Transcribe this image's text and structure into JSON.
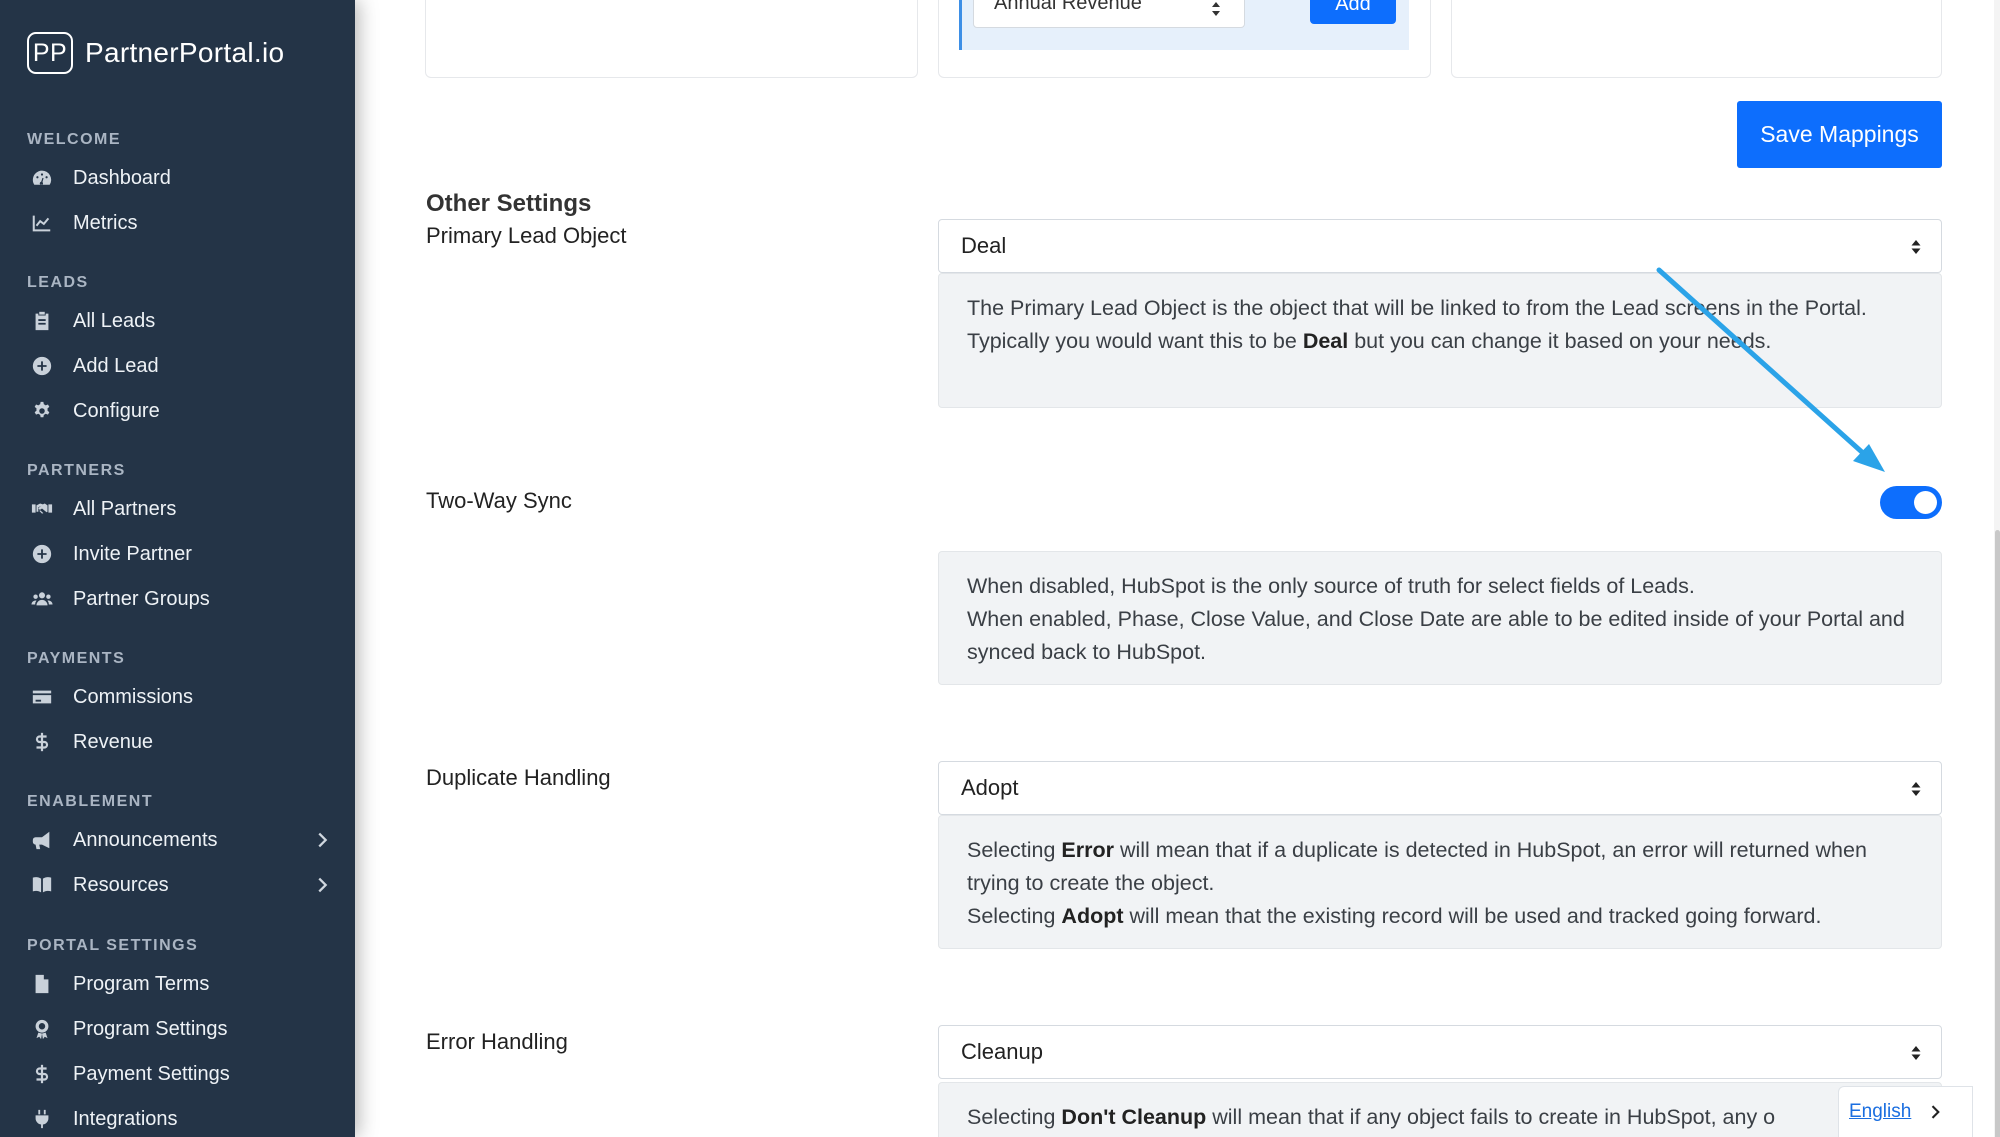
{
  "brand": {
    "logo": "PP",
    "name": "PartnerPortal.io"
  },
  "sidebar": {
    "sections": [
      {
        "title": "WELCOME",
        "items": [
          {
            "label": "Dashboard",
            "icon": "dashboard-gauge-icon"
          },
          {
            "label": "Metrics",
            "icon": "line-chart-icon"
          }
        ]
      },
      {
        "title": "LEADS",
        "items": [
          {
            "label": "All Leads",
            "icon": "clipboard-icon"
          },
          {
            "label": "Add Lead",
            "icon": "plus-circle-icon"
          },
          {
            "label": "Configure",
            "icon": "gear-icon"
          }
        ]
      },
      {
        "title": "PARTNERS",
        "items": [
          {
            "label": "All Partners",
            "icon": "handshake-icon"
          },
          {
            "label": "Invite Partner",
            "icon": "plus-circle-icon"
          },
          {
            "label": "Partner Groups",
            "icon": "users-icon"
          }
        ]
      },
      {
        "title": "PAYMENTS",
        "items": [
          {
            "label": "Commissions",
            "icon": "credit-card-icon"
          },
          {
            "label": "Revenue",
            "icon": "dollar-icon"
          }
        ]
      },
      {
        "title": "ENABLEMENT",
        "items": [
          {
            "label": "Announcements",
            "icon": "megaphone-icon"
          },
          {
            "label": "Resources",
            "icon": "book-icon"
          }
        ]
      },
      {
        "title": "PORTAL SETTINGS",
        "items": [
          {
            "label": "Program Terms",
            "icon": "file-icon"
          },
          {
            "label": "Program Settings",
            "icon": "award-icon"
          },
          {
            "label": "Payment Settings",
            "icon": "dollar-icon"
          },
          {
            "label": "Integrations",
            "icon": "plug-icon"
          }
        ]
      }
    ]
  },
  "mapping": {
    "select_value": "Annual Revenue",
    "add_label": "Add",
    "save_label": "Save Mappings"
  },
  "settings": {
    "title": "Other Settings",
    "primary_lead": {
      "label": "Primary Lead Object",
      "value": "Deal",
      "help": {
        "before": "The Primary Lead Object is the object that will be linked to from the Lead screens in the Portal. Typically you would want this to be ",
        "bold": "Deal",
        "after": " but you can change it based on your needs."
      }
    },
    "two_way_sync": {
      "label": "Two-Way Sync",
      "enabled": true,
      "help_line1": "When disabled, HubSpot is the only source of truth for select fields of Leads.",
      "help_line2": "When enabled, Phase, Close Value, and Close Date are able to be edited inside of your Portal and synced back to HubSpot."
    },
    "duplicate": {
      "label": "Duplicate Handling",
      "value": "Adopt",
      "help": {
        "l1_pre": "Selecting ",
        "l1_bold": "Error",
        "l1_post": " will mean that if a duplicate is detected in HubSpot, an error will returned when trying to create the object.",
        "l2_pre": "Selecting ",
        "l2_bold": "Adopt",
        "l2_post": " will mean that the existing record will be used and tracked going forward."
      }
    },
    "error": {
      "label": "Error Handling",
      "value": "Cleanup",
      "help": {
        "pre": "Selecting ",
        "bold": "Don't Cleanup",
        "post": " will mean that if any object fails to create in HubSpot, any o"
      }
    }
  },
  "language": {
    "label": "English"
  },
  "colors": {
    "sidebar": "#243447",
    "accent": "#0d6efd",
    "annotation": "#2ba3e8"
  }
}
